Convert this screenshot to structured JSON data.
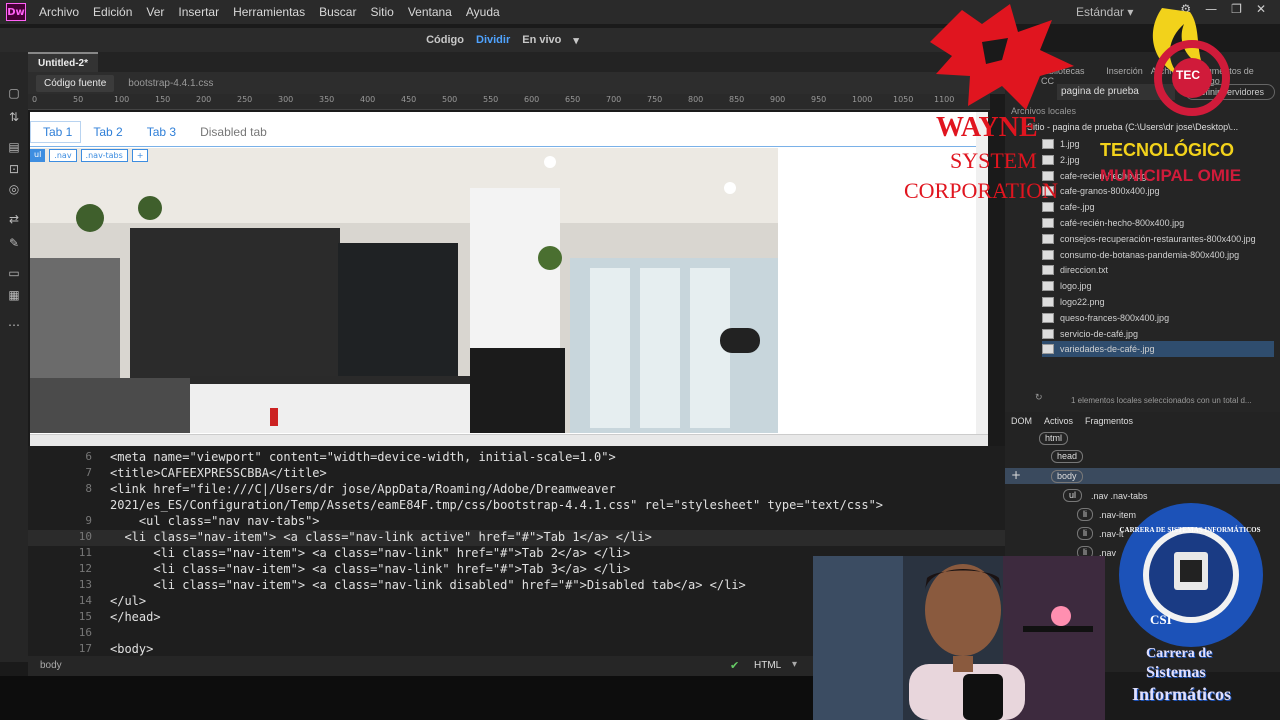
{
  "app": {
    "logo_text": "Dw",
    "menu": [
      "Archivo",
      "Edición",
      "Ver",
      "Insertar",
      "Herramientas",
      "Buscar",
      "Sitio",
      "Ventana",
      "Ayuda"
    ],
    "workspace": "Estándar"
  },
  "view_switcher": {
    "code": "Código",
    "split": "Dividir",
    "live": "En vivo"
  },
  "document": {
    "tab": "Untitled-2*",
    "source_tabs": [
      "Código fuente",
      "bootstrap-4.4.1.css"
    ]
  },
  "ruler_ticks": [
    "0",
    "50",
    "100",
    "150",
    "200",
    "250",
    "300",
    "350",
    "400",
    "450",
    "500",
    "550",
    "600",
    "650",
    "700",
    "750",
    "800",
    "850",
    "900",
    "950",
    "1000",
    "1050",
    "1100"
  ],
  "live_view": {
    "nav_tabs": [
      "Tab 1",
      "Tab 2",
      "Tab 3",
      "Disabled tab"
    ],
    "tag_selector": [
      "ul",
      ".nav",
      ".nav-tabs",
      "+"
    ]
  },
  "code": {
    "line_numbers": [
      "6",
      "7",
      "8",
      "",
      "9",
      "10",
      "11",
      "12",
      "13",
      "14",
      "15",
      "16",
      "17"
    ],
    "lines": [
      "<meta name=\"viewport\" content=\"width=device-width, initial-scale=1.0\">",
      "<title>CAFEEXPRESSCBBA</title>",
      "<link href=\"file:///C|/Users/dr jose/AppData/Roaming/Adobe/Dreamweaver",
      "2021/es_ES/Configuration/Temp/Assets/eamE84F.tmp/css/bootstrap-4.4.1.css\" rel=\"stylesheet\" type=\"text/css\">",
      "    <ul class=\"nav nav-tabs\">",
      "  <li class=\"nav-item\"> <a class=\"nav-link active\" href=\"#\">Tab 1</a> </li>",
      "      <li class=\"nav-item\"> <a class=\"nav-link\" href=\"#\">Tab 2</a> </li>",
      "      <li class=\"nav-item\"> <a class=\"nav-link\" href=\"#\">Tab 3</a> </li>",
      "      <li class=\"nav-item\"> <a class=\"nav-link disabled\" href=\"#\">Disabled tab</a> </li>",
      "</ul>",
      "</head>",
      "",
      "<body>"
    ]
  },
  "status": {
    "tag": "body",
    "mode": "HTML"
  },
  "files_panel": {
    "header_tabs": [
      "Bibliotecas CC",
      "Inserción",
      "Archivos",
      "Fragmentos de código"
    ],
    "site_select": "pagina de prueba",
    "server_select": "Definir servidores",
    "local_label": "Archivos locales",
    "root": "Sitio - pagina de prueba (C:\\Users\\dr jose\\Desktop\\...",
    "files": [
      "1.jpg",
      "2.jpg",
      "cafe-recien-hecho.jpg",
      "cafe-granos-800x400.jpg",
      "cafe-.jpg",
      "café-recién-hecho-800x400.jpg",
      "consejos-recuperación-restaurantes-800x400.jpg",
      "consumo-de-botanas-pandemia-800x400.jpg",
      "direccion.txt",
      "logo.jpg",
      "logo22.png",
      "queso-frances-800x400.jpg",
      "servicio-de-café.jpg",
      "variedades-de-café-.jpg"
    ],
    "selection_status": "1 elementos locales seleccionados con un total d..."
  },
  "dom_panel": {
    "tabs": [
      "DOM",
      "Activos",
      "Fragmentos"
    ],
    "nodes": [
      "html",
      "head",
      "body",
      "ul",
      ".nav .nav-tabs",
      "li",
      ".nav-item",
      "li",
      ".nav-it",
      "li",
      ".nav"
    ]
  },
  "overlays": {
    "wayne": [
      "WAYNE",
      "SYSTEM",
      "CORPORATION"
    ],
    "tec_badge": "TEC",
    "tec_text": [
      "TECNOLÓGICO",
      "MUNICIPAL OMIE"
    ],
    "csi_ring": "CARRERA DE SISTEMAS INFORMÁTICOS",
    "csi_center": "CSI",
    "csi_caption": [
      "Carrera de",
      "Sistemas",
      "Informáticos"
    ]
  },
  "colors": {
    "accent": "#4fa3ff",
    "tag": "#ff7a7a",
    "attr": "#9fd36a",
    "str": "#f0c060",
    "wayne": "#e0151f",
    "csi": "#1c52b8"
  }
}
